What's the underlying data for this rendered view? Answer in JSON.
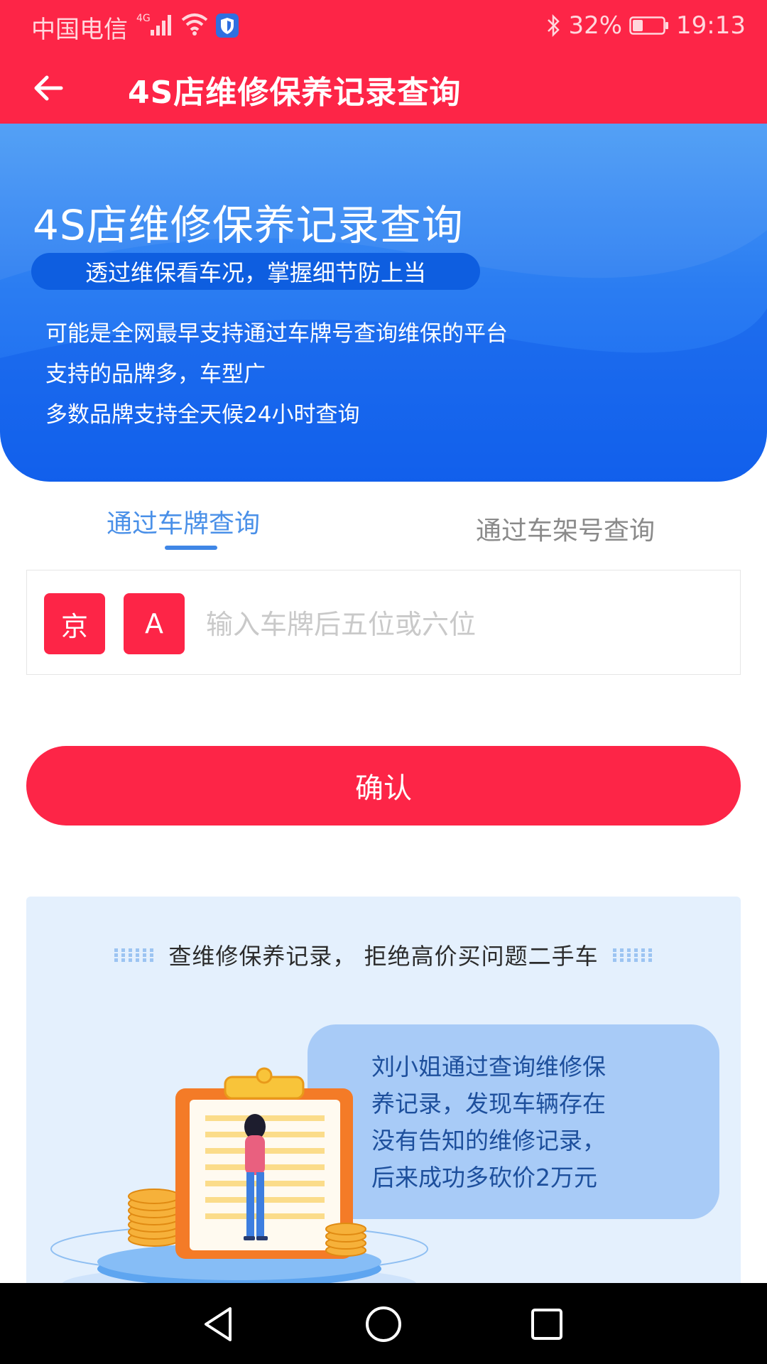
{
  "status_bar": {
    "carrier": "中国电信",
    "network": "4G",
    "battery": "32%",
    "time": "19:13"
  },
  "header": {
    "title": "4S店维修保养记录查询",
    "back_icon": "arrow-left-icon"
  },
  "hero": {
    "title": "4S店维修保养记录查询",
    "tagline": "透过维保看车况，掌握细节防上当",
    "features": [
      "可能是全网最早支持通过车牌号查询维保的平台",
      "支持的品牌多，车型广",
      "多数品牌支持全天候24小时查询"
    ]
  },
  "tabs": [
    {
      "label": "通过车牌查询",
      "active": true
    },
    {
      "label": "通过车架号查询",
      "active": false
    }
  ],
  "plate_form": {
    "province": "京",
    "letter": "A",
    "placeholder": "输入车牌后五位或六位",
    "value": ""
  },
  "confirm_label": "确认",
  "promo": {
    "heading": "查维修保养记录， 拒绝高价买问题二手车",
    "story": [
      "刘小姐通过查询维修保",
      "养记录，发现车辆存在",
      "没有告知的维修记录，",
      "后来成功多砍价2万元"
    ]
  },
  "nav": {
    "back_icon": "triangle-back-icon",
    "home_icon": "circle-home-icon",
    "recents_icon": "square-recents-icon"
  },
  "colors": {
    "primary_red": "#fd2547",
    "hero_blue": "#1565f0",
    "tab_active": "#4a90e8"
  }
}
